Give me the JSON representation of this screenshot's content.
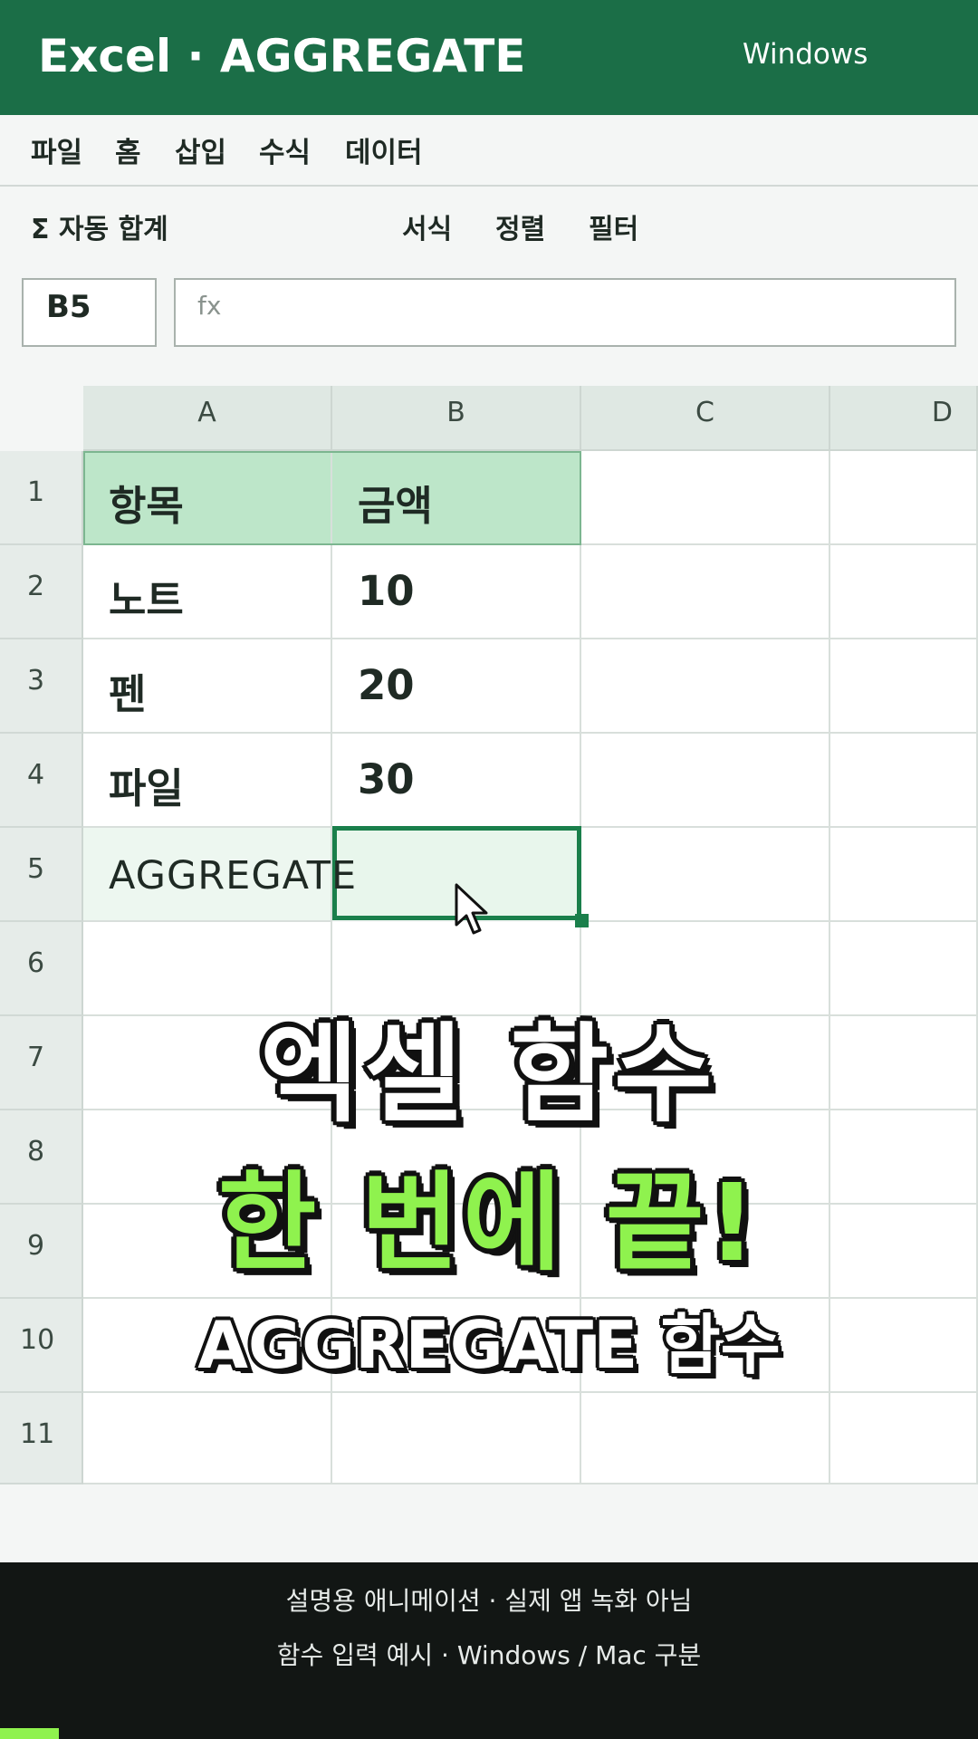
{
  "window": {
    "title": "Excel · AGGREGATE",
    "platform": "Windows"
  },
  "menu": [
    "파일",
    "홈",
    "삽입",
    "수식",
    "데이터"
  ],
  "ribbon": {
    "autosum": "Σ 자동 합계",
    "format": "서식",
    "sort": "정렬",
    "filter": "필터"
  },
  "formula_bar": {
    "cell_ref": "B5",
    "fx_label": "fx",
    "value": ""
  },
  "sheet": {
    "columns": [
      "A",
      "B",
      "C",
      "D"
    ],
    "rows": [
      "1",
      "2",
      "3",
      "4",
      "5",
      "6",
      "7",
      "8",
      "9",
      "10",
      "11"
    ],
    "cells": {
      "A1": "항목",
      "B1": "금액",
      "A2": "노트",
      "B2": "10",
      "A3": "펜",
      "B3": "20",
      "A4": "파일",
      "B4": "30",
      "A5": "AGGREGATE"
    },
    "active_cell": "B5"
  },
  "overlay": {
    "line1": "엑셀 함수",
    "line2": "한 번에 끝!",
    "line3": "AGGREGATE 함수"
  },
  "footer": {
    "line1": "설명용 애니메이션 · 실제 앱 녹화 아님",
    "line2": "함수 입력 예시 · Windows / Mac 구분"
  },
  "progress": {
    "fraction": 0.06
  },
  "colors": {
    "brand": "#1b6e47",
    "accent": "#8ff24e",
    "header_fill": "#bde6c9",
    "active_border": "#1a7f4b"
  }
}
